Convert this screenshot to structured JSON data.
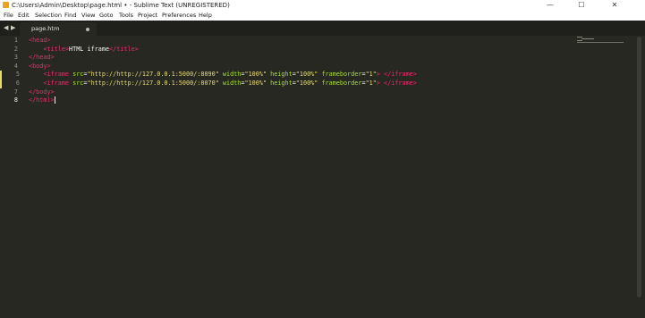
{
  "window": {
    "title": "C:\\Users\\Admin\\Desktop\\page.html • - Sublime Text (UNREGISTERED)",
    "minimize": "—",
    "maximize": "☐",
    "close": "✕"
  },
  "menu": [
    "File",
    "Edit",
    "Selection",
    "Find",
    "View",
    "Goto",
    "Tools",
    "Project",
    "Preferences",
    "Help"
  ],
  "tabs": {
    "prev": "◀",
    "next": "▶",
    "active": {
      "label": "page.htm",
      "modified": true
    }
  },
  "editor": {
    "line_numbers": [
      "1",
      "2",
      "3",
      "4",
      "5",
      "6",
      "7",
      "8"
    ],
    "lines": [
      [
        [
          "t",
          "<head>"
        ]
      ],
      [
        [
          "p",
          "    "
        ],
        [
          "t",
          "<title>"
        ],
        [
          "p",
          "HTML iframe"
        ],
        [
          "t",
          "</title>"
        ]
      ],
      [
        [
          "t",
          "</head>"
        ]
      ],
      [
        [
          "t",
          "<body>"
        ]
      ],
      [
        [
          "p",
          "    "
        ],
        [
          "t",
          "<iframe"
        ],
        [
          "p",
          " "
        ],
        [
          "a",
          "src"
        ],
        [
          "p",
          "="
        ],
        [
          "s",
          "\"http://http://127.0.0.1:5000/:8090\""
        ],
        [
          "p",
          " "
        ],
        [
          "a",
          "width"
        ],
        [
          "p",
          "="
        ],
        [
          "s",
          "\"100%\""
        ],
        [
          "p",
          " "
        ],
        [
          "a",
          "height"
        ],
        [
          "p",
          "="
        ],
        [
          "s",
          "\"100%\""
        ],
        [
          "p",
          " "
        ],
        [
          "a",
          "frameborder"
        ],
        [
          "p",
          "="
        ],
        [
          "s",
          "\"1\""
        ],
        [
          "t",
          "> </iframe>"
        ]
      ],
      [
        [
          "p",
          "    "
        ],
        [
          "t",
          "<iframe"
        ],
        [
          "p",
          " "
        ],
        [
          "a",
          "src"
        ],
        [
          "p",
          "="
        ],
        [
          "s",
          "\"http://http://127.0.0.1:5000/:8070\""
        ],
        [
          "p",
          " "
        ],
        [
          "a",
          "width"
        ],
        [
          "p",
          "="
        ],
        [
          "s",
          "\"100%\""
        ],
        [
          "p",
          " "
        ],
        [
          "a",
          "height"
        ],
        [
          "p",
          "="
        ],
        [
          "s",
          "\"100%\""
        ],
        [
          "p",
          " "
        ],
        [
          "a",
          "frameborder"
        ],
        [
          "p",
          "="
        ],
        [
          "s",
          "\"1\""
        ],
        [
          "t",
          "> </iframe>"
        ]
      ],
      [
        [
          "t",
          "</body>"
        ]
      ],
      [
        [
          "t",
          "</html>"
        ]
      ]
    ],
    "modified_lines": [
      5,
      6
    ],
    "current_line": 8
  },
  "colors": {
    "background": "#272822",
    "tag": "#f92672",
    "attribute": "#a6e22e",
    "string": "#e6db74",
    "text": "#f8f8f2",
    "gutter": "#8f908a"
  }
}
